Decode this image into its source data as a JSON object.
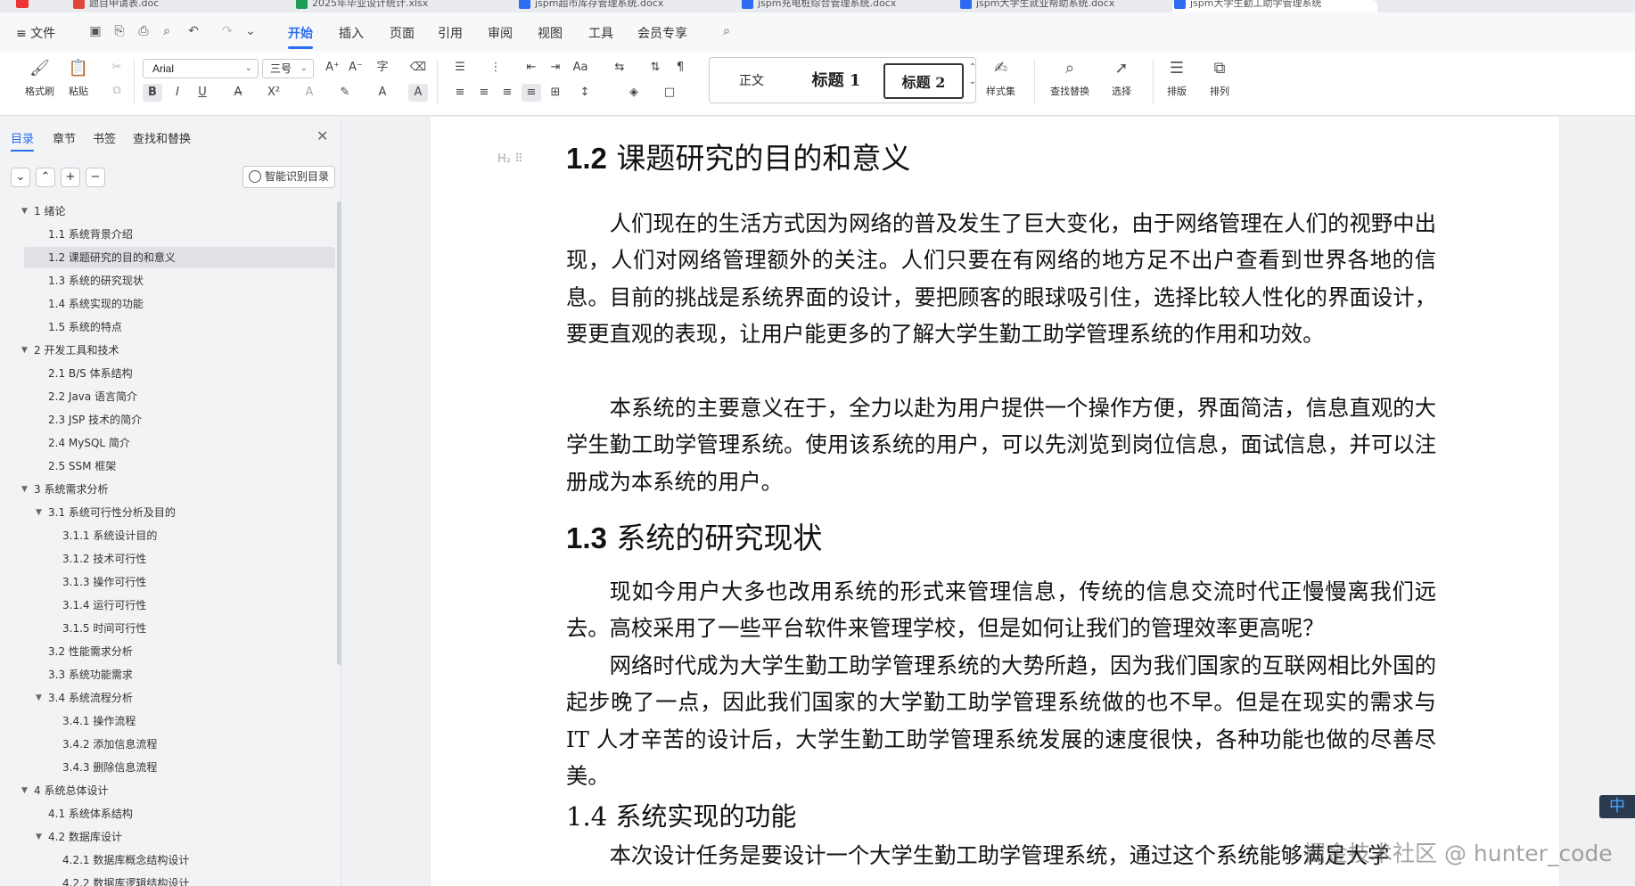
{
  "tabbar": {
    "tabs": [
      {
        "label": "题目申请表.doc",
        "color": "#e0463c"
      },
      {
        "label": "2025年毕业设计统计.xlsx",
        "color": "#1f9d55"
      },
      {
        "label": "jspm超市库存管理系统.docx",
        "color": "#2b6cf0"
      },
      {
        "label": "jspm充电桩综合管理系统.docx",
        "color": "#2b6cf0"
      },
      {
        "label": "jspm大学生就业帮助系统.docx",
        "color": "#2b6cf0"
      },
      {
        "label": "jspm大学生勤工助学管理系统",
        "color": "#2b6cf0"
      }
    ]
  },
  "menu": {
    "file": "≡ 文件",
    "items": [
      "开始",
      "插入",
      "页面",
      "引用",
      "审阅",
      "视图",
      "工具",
      "会员专享"
    ],
    "active": "开始"
  },
  "ribbon": {
    "format_painter": "格式刷",
    "paste": "粘贴",
    "font_name": "Arial",
    "font_size": "三号",
    "style_normal": "正文",
    "style_h1": "标题 1",
    "style_h2": "标题 2",
    "style_set": "样式集",
    "find_replace": "查找替换",
    "select": "选择",
    "layout": "排版",
    "arrange": "排列"
  },
  "nav": {
    "tabs": [
      "目录",
      "章节",
      "书签",
      "查找和替换"
    ],
    "active_tab": "目录",
    "smart_button": "智能识别目录",
    "toc": [
      {
        "label": "1  绪论",
        "level": 1,
        "toggle": true
      },
      {
        "label": "1.1 系统背景介绍",
        "level": 2
      },
      {
        "label": "1.2 课题研究的目的和意义",
        "level": 2,
        "selected": true
      },
      {
        "label": "1.3 系统的研究现状",
        "level": 2
      },
      {
        "label": "1.4 系统实现的功能",
        "level": 2
      },
      {
        "label": "1.5 系统的特点",
        "level": 2
      },
      {
        "label": "2  开发工具和技术",
        "level": 1,
        "toggle": true
      },
      {
        "label": "2.1 B/S 体系结构",
        "level": 2
      },
      {
        "label": "2.2 Java 语言简介",
        "level": 2
      },
      {
        "label": "2.3 JSP 技术的简介",
        "level": 2
      },
      {
        "label": "2.4 MySQL 简介",
        "level": 2
      },
      {
        "label": "2.5 SSM 框架",
        "level": 2
      },
      {
        "label": "3  系统需求分析",
        "level": 1,
        "toggle": true
      },
      {
        "label": "3.1  系统可行性分析及目的",
        "level": 2,
        "toggle": true
      },
      {
        "label": "3.1.1  系统设计目的",
        "level": 3
      },
      {
        "label": "3.1.2  技术可行性",
        "level": 3
      },
      {
        "label": "3.1.3  操作可行性",
        "level": 3
      },
      {
        "label": "3.1.4  运行可行性",
        "level": 3
      },
      {
        "label": "3.1.5  时间可行性",
        "level": 3
      },
      {
        "label": "3.2  性能需求分析",
        "level": 2
      },
      {
        "label": "3.3 系统功能需求",
        "level": 2
      },
      {
        "label": "3.4 系统流程分析",
        "level": 2,
        "toggle": true
      },
      {
        "label": "3.4.1 操作流程",
        "level": 3
      },
      {
        "label": "3.4.2 添加信息流程",
        "level": 3
      },
      {
        "label": "3.4.3 删除信息流程",
        "level": 3
      },
      {
        "label": "4     系统总体设计",
        "level": 1,
        "toggle": true
      },
      {
        "label": "4.1  系统体系结构",
        "level": 2
      },
      {
        "label": "4.2  数据库设计",
        "level": 2,
        "toggle": true
      },
      {
        "label": "4.2.1  数据库概念结构设计",
        "level": 3
      },
      {
        "label": "4.2.2  数据库逻辑结构设计",
        "level": 3
      }
    ]
  },
  "document": {
    "h_1_2_num": "1.2",
    "h_1_2_text": "课题研究的目的和意义",
    "p1": "人们现在的生活方式因为网络的普及发生了巨大变化，由于网络管理在人们的视野中出现，人们对网络管理额外的关注。人们只要在有网络的地方足不出户查看到世界各地的信息。目前的挑战是系统界面的设计，要把顾客的眼球吸引住，选择比较人性化的界面设计，要更直观的表现，让用户能更多的了解大学生勤工助学管理系统的作用和功效。",
    "p2": "本系统的主要意义在于，全力以赴为用户提供一个操作方便，界面简洁，信息直观的大学生勤工助学管理系统。使用该系统的用户，可以先浏览到岗位信息，面试信息，并可以注册成为本系统的用户。",
    "h_1_3_num": "1.3",
    "h_1_3_text": "系统的研究现状",
    "p3": "现如今用户大多也改用系统的形式来管理信息，传统的信息交流时代正慢慢离我们远去。高校采用了一些平台软件来管理学校，但是如何让我们的管理效率更高呢？",
    "p4": "网络时代成为大学生勤工助学管理系统的大势所趋，因为我们国家的互联网相比外国的起步晚了一点，因此我们国家的大学勤工助学管理系统做的也不早。但是在现实的需求与 IT 人才辛苦的设计后，大学生勤工助学管理系统发展的速度很快，各种功能也做的尽善尽美。",
    "h_1_4": "1.4 系统实现的功能",
    "p5": "本次设计任务是要设计一个大学生勤工助学管理系统，通过这个系统能够满足大学"
  },
  "watermark": "掘金技术社区 @ hunter_code",
  "ime": "中"
}
